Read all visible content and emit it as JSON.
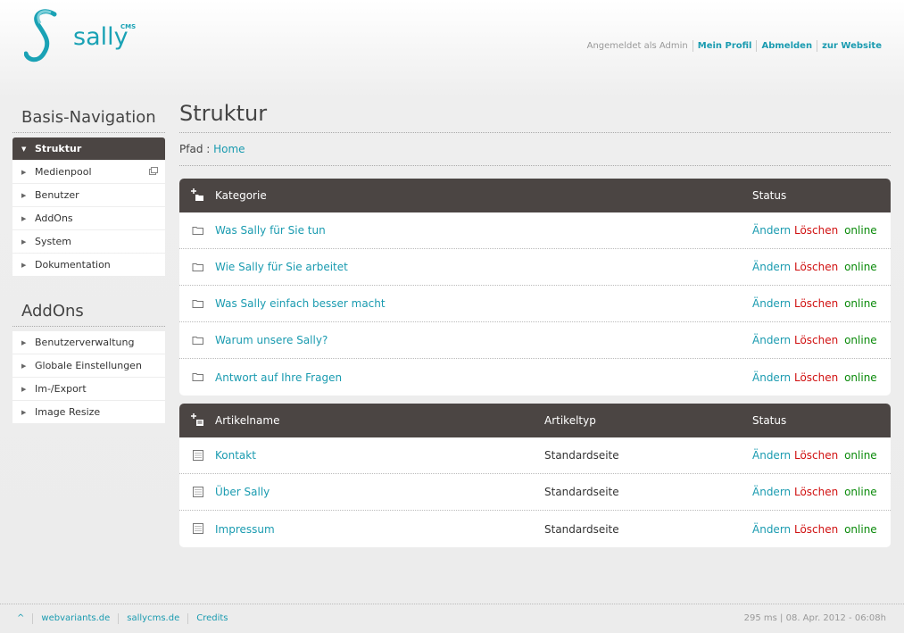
{
  "header": {
    "logo_text": "sally",
    "logo_sup": "CMS",
    "logged_in": "Angemeldet als Admin",
    "my_profile": "Mein Profil",
    "logout": "Abmelden",
    "to_website": "zur Website"
  },
  "sidebar": {
    "basis_heading": "Basis-Navigation",
    "basis_items": [
      {
        "label": "Struktur"
      },
      {
        "label": "Medienpool"
      },
      {
        "label": "Benutzer"
      },
      {
        "label": "AddOns"
      },
      {
        "label": "System"
      },
      {
        "label": "Dokumentation"
      }
    ],
    "addons_heading": "AddOns",
    "addons_items": [
      {
        "label": "Benutzerverwaltung"
      },
      {
        "label": "Globale Einstellungen"
      },
      {
        "label": "Im-/Export"
      },
      {
        "label": "Image Resize"
      }
    ]
  },
  "main": {
    "title": "Struktur",
    "path_label": "Pfad :",
    "path_home": "Home",
    "categories": {
      "col_name": "Kategorie",
      "col_status": "Status",
      "rows": [
        {
          "name": "Was Sally für Sie tun",
          "edit": "Ändern",
          "delete": "Löschen",
          "status": "online"
        },
        {
          "name": "Wie Sally für Sie arbeitet",
          "edit": "Ändern",
          "delete": "Löschen",
          "status": "online"
        },
        {
          "name": "Was Sally einfach besser macht",
          "edit": "Ändern",
          "delete": "Löschen",
          "status": "online"
        },
        {
          "name": "Warum unsere Sally?",
          "edit": "Ändern",
          "delete": "Löschen",
          "status": "online"
        },
        {
          "name": "Antwort auf Ihre Fragen",
          "edit": "Ändern",
          "delete": "Löschen",
          "status": "online"
        }
      ]
    },
    "articles": {
      "col_name": "Artikelname",
      "col_type": "Artikeltyp",
      "col_status": "Status",
      "rows": [
        {
          "name": "Kontakt",
          "type": "Standardseite",
          "edit": "Ändern",
          "delete": "Löschen",
          "status": "online"
        },
        {
          "name": "Über Sally",
          "type": "Standardseite",
          "edit": "Ändern",
          "delete": "Löschen",
          "status": "online"
        },
        {
          "name": "Impressum",
          "type": "Standardseite",
          "edit": "Ändern",
          "delete": "Löschen",
          "status": "online"
        }
      ]
    }
  },
  "footer": {
    "top": "^",
    "link1": "webvariants.de",
    "link2": "sallycms.de",
    "link3": "Credits",
    "info": "295 ms | 08. Apr. 2012 - 06:08h"
  },
  "colors": {
    "accent": "#1a9bb0",
    "dark": "#4b4543",
    "delete": "#d01010",
    "online": "#0a8a0a"
  }
}
